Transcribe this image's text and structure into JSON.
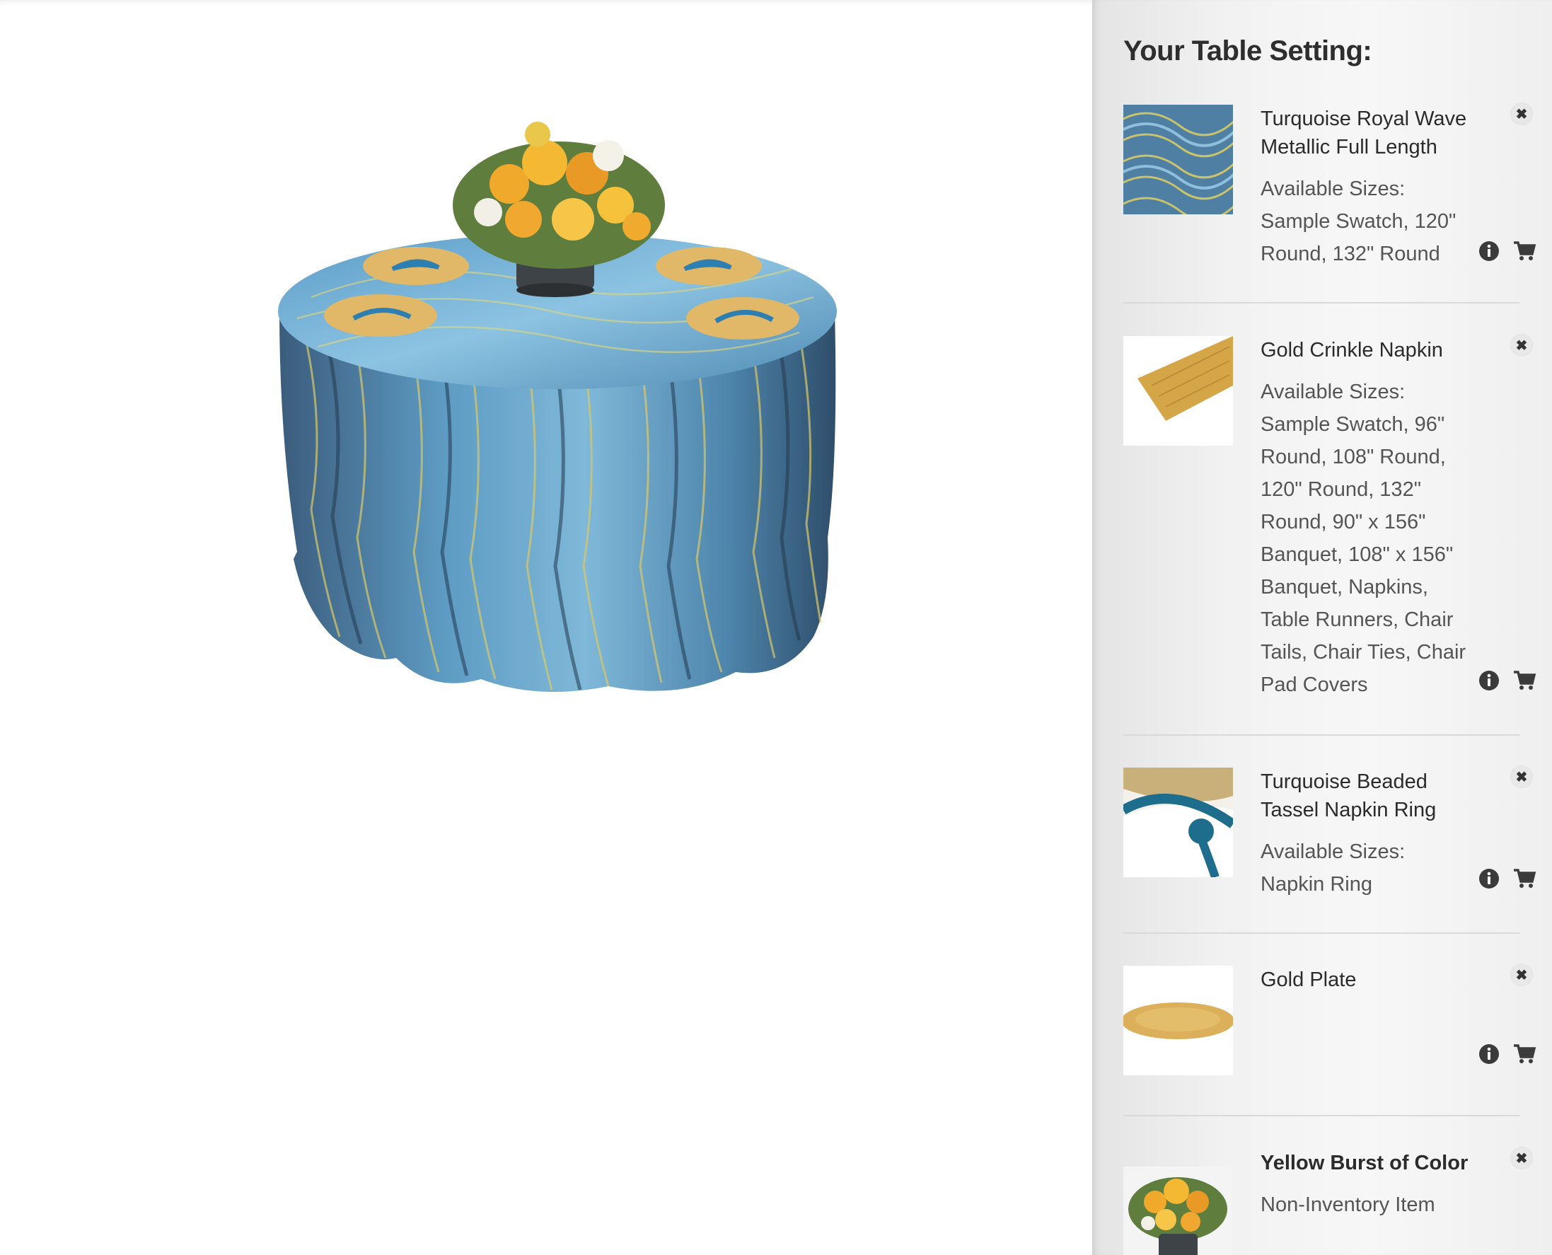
{
  "sidebar": {
    "title": "Your Table Setting:",
    "items": [
      {
        "name": "Turquoise Royal Wave Metallic Full Length",
        "sizes_label": "Available Sizes:",
        "sizes": "Sample Swatch, 120\" Round, 132\" Round",
        "thumb": "turquoise-wave-fabric"
      },
      {
        "name": "Gold Crinkle Napkin",
        "sizes_label": "Available Sizes:",
        "sizes": "Sample Swatch, 96\" Round, 108\" Round, 120\" Round, 132\" Round, 90\" x 156\" Banquet, 108\" x 156\" Banquet, Napkins, Table Runners, Chair Tails, Chair Ties, Chair Pad Covers",
        "thumb": "gold-napkin"
      },
      {
        "name": "Turquoise Beaded Tassel Napkin Ring",
        "sizes_label": "Available Sizes:",
        "sizes": "Napkin Ring",
        "thumb": "turquoise-napkin-ring"
      },
      {
        "name": "Gold Plate",
        "sizes_label": "",
        "sizes": "",
        "thumb": "gold-plate"
      },
      {
        "name": "Yellow Burst of Color",
        "sizes_label": "",
        "sizes": "Non-Inventory Item",
        "thumb": "yellow-flower-arrangement"
      }
    ]
  },
  "icons": {
    "close": "close-icon",
    "info": "info-icon",
    "cart": "add-to-cart-icon"
  },
  "colors": {
    "accent_blue": "#5b9ec9",
    "gold": "#d9b163"
  }
}
